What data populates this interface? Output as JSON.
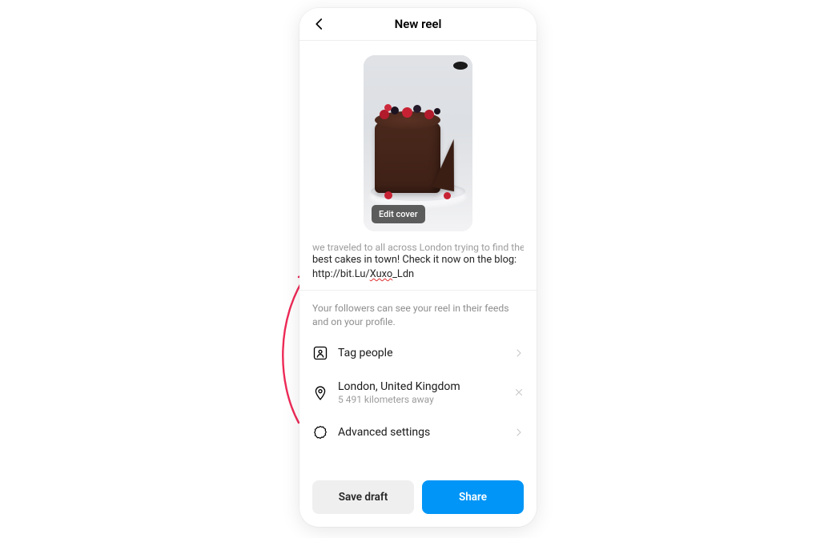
{
  "header": {
    "title": "New reel"
  },
  "cover": {
    "edit_label": "Edit cover"
  },
  "caption": {
    "cut_line": "we traveled to all across London trying to find the",
    "line_before_spell": "best cakes in town! Check it now on the blog: http://bit.Lu/",
    "spell_word": "Xuxo",
    "line_after_spell": "_Ldn"
  },
  "note": {
    "text": "Your followers can see your reel in their feeds and on your profile."
  },
  "rows": {
    "tag": {
      "title": "Tag people"
    },
    "location": {
      "title": "London, United Kingdom",
      "sub": "5 491 kilometers away"
    },
    "advanced": {
      "title": "Advanced settings"
    }
  },
  "footer": {
    "draft": "Save draft",
    "share": "Share"
  }
}
